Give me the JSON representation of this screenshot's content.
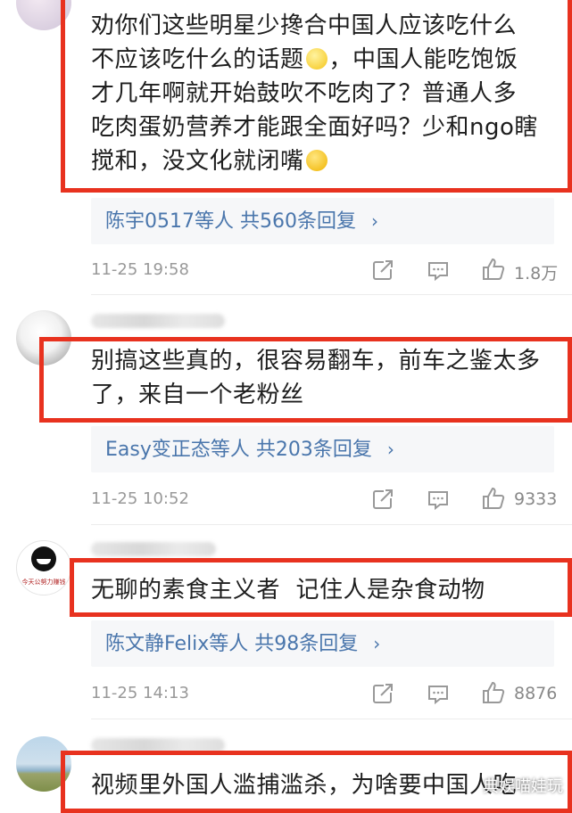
{
  "comments": [
    {
      "text_lines": [
        "劝你们这些明星少搀合中国人应该吃什么",
        "不应该吃什么的话题",
        "，中国人能吃饱饭",
        "才几年啊就开始鼓吹不吃肉了？普通人多",
        "吃肉蛋奶营养才能跟全面好吗？少和ngo瞎",
        "搅和，没文化就闭嘴"
      ],
      "reply_users": "陈宇0517等人",
      "reply_count": "共560条回复",
      "time": "11-25 19:58",
      "likes": "1.8万"
    },
    {
      "text_lines": [
        "别搞这些真的，很容易翻车，前车之鉴太多",
        "了，来自一个老粉丝"
      ],
      "reply_users": "Easy变正态等人",
      "reply_count": "共203条回复",
      "time": "11-25 10:52",
      "likes": "9333"
    },
    {
      "text_lines": [
        "无聊的素食主义者  记住人是杂食动物"
      ],
      "avatar_text": "今天公努力赚钱",
      "reply_users": "陈文静Felix等人",
      "reply_count": "共98条回复",
      "time": "11-25 14:13",
      "likes": "8876"
    },
    {
      "text_lines": [
        "视频里外国人滥捕滥杀，为啥要中国人吃"
      ]
    }
  ],
  "arrow": "›",
  "watermark": "典娱喵娃玩",
  "colors": {
    "highlight_box": "#e8321f",
    "reply_link": "#4a76ac",
    "meta_gray": "#999999"
  }
}
